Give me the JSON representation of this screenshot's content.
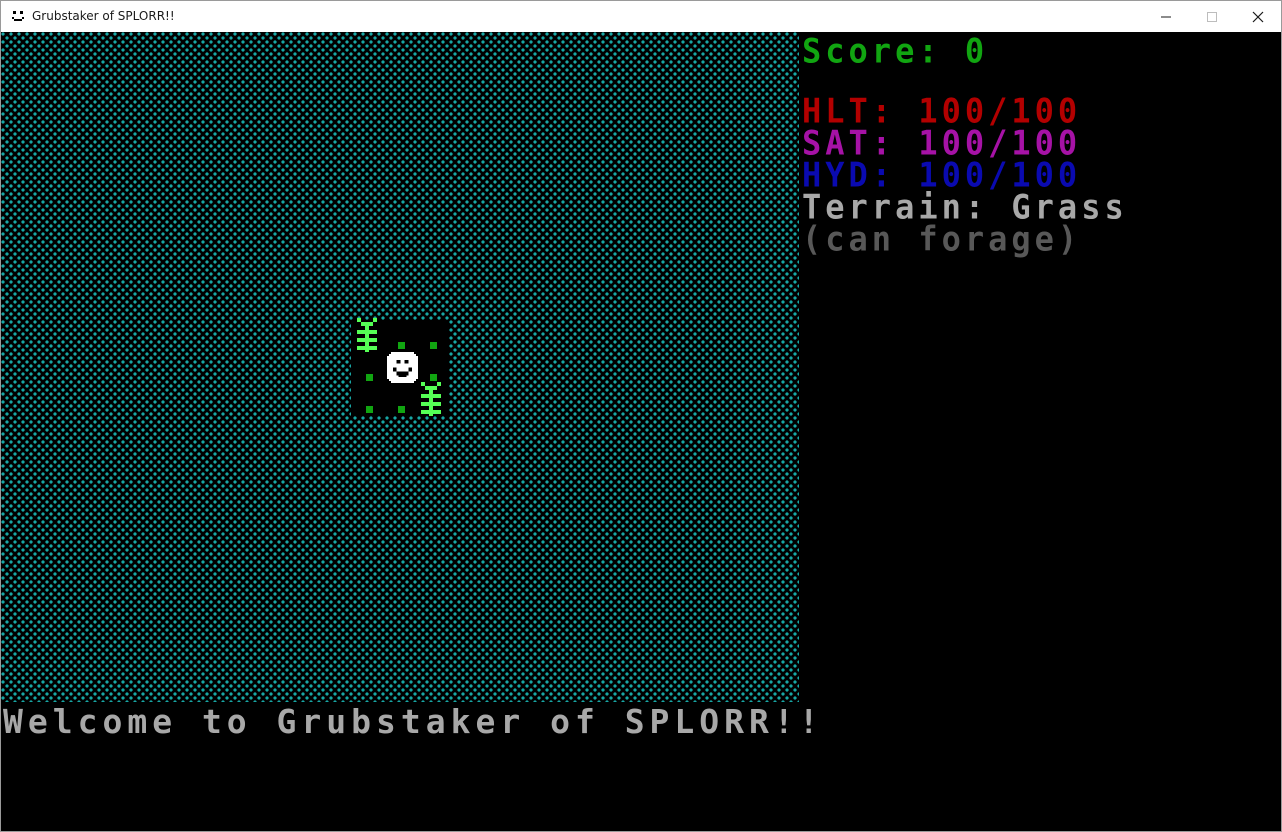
{
  "window": {
    "title": "Grubstaker of SPLORR!!"
  },
  "hud": {
    "score_label": "Score: 0",
    "health": "HLT: 100/100",
    "satiety": "SAT: 100/100",
    "hydration": "HYD: 100/100",
    "terrain": "Terrain: Grass",
    "terrain_note": "(can forage)"
  },
  "message_log": {
    "line1": "Welcome to Grubstaker of SPLORR!!"
  },
  "colors": {
    "water": "#18a7a5",
    "grass": "#11a511",
    "plant": "#55ff55",
    "health": "#b30000",
    "satiety": "#a612a6",
    "hydration": "#0a0ab0",
    "text_gray": "#a8a8a8",
    "text_dark_gray": "#585858"
  },
  "icons": {
    "app": "smiley-icon",
    "player": "smiley-player-icon",
    "plant": "forage-plant-icon"
  }
}
